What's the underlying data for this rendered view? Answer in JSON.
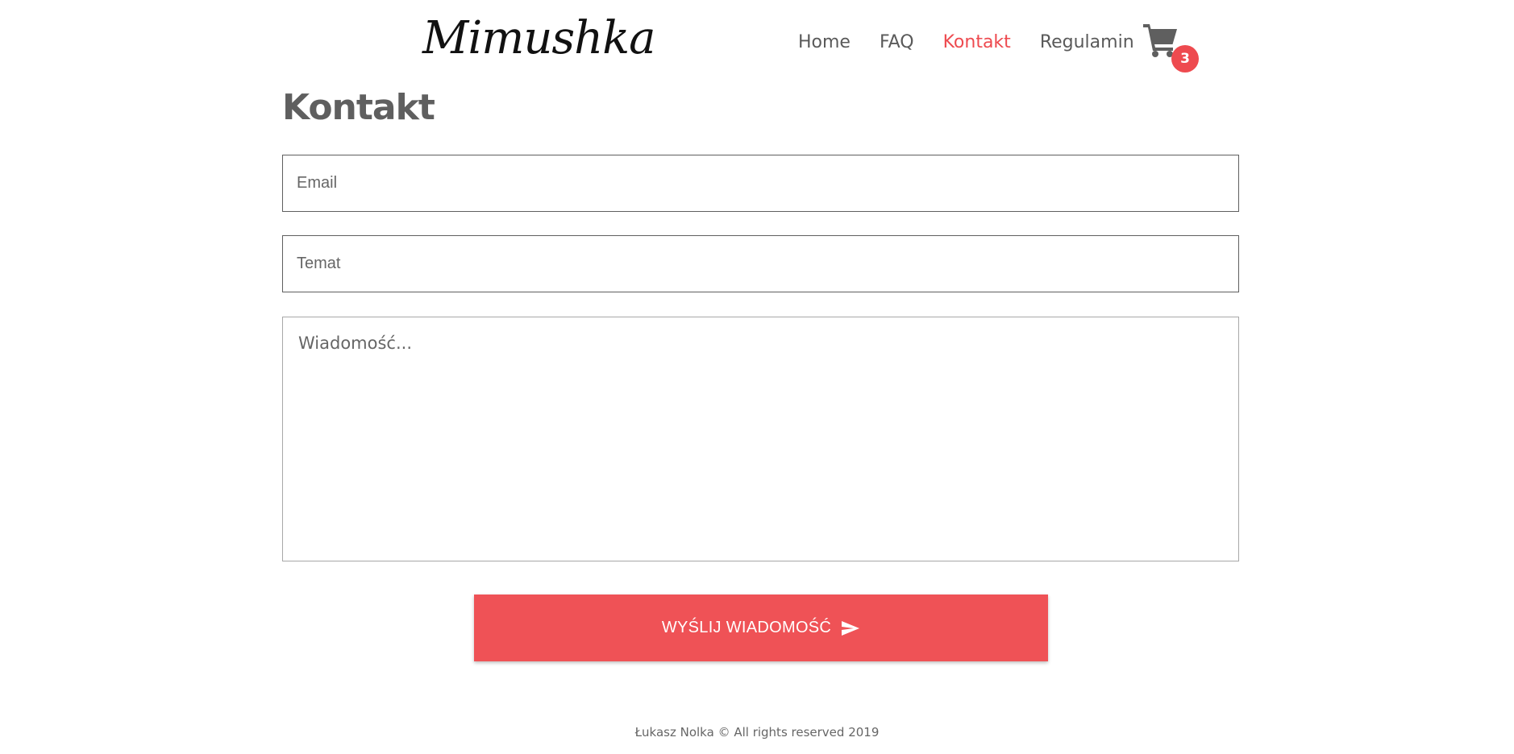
{
  "header": {
    "logo": "Mimushka",
    "nav": [
      {
        "label": "Home",
        "active": false
      },
      {
        "label": "FAQ",
        "active": false
      },
      {
        "label": "Kontakt",
        "active": true
      },
      {
        "label": "Regulamin",
        "active": false
      }
    ],
    "cart": {
      "icon": "shopping-cart-icon",
      "count": "3"
    }
  },
  "main": {
    "title": "Kontakt",
    "form": {
      "email_placeholder": "Email",
      "subject_placeholder": "Temat",
      "message_placeholder": "Wiadomość...",
      "submit_label": "WYŚLIJ WIADOMOŚĆ",
      "submit_icon": "send-icon"
    }
  },
  "footer": {
    "text": "Łukasz Nolka © All rights reserved 2019"
  },
  "colors": {
    "accent": "#ee4a4f",
    "text": "#5f5f5f",
    "background": "#ffffff"
  }
}
